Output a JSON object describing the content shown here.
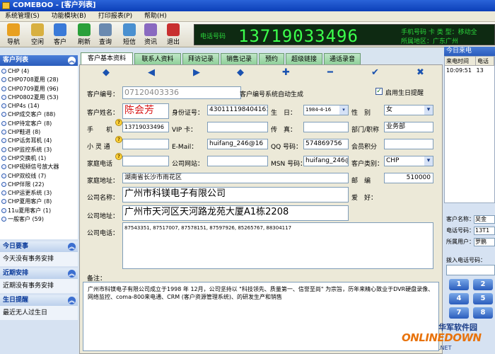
{
  "window": {
    "title": "COMEBOO - [客户列表]"
  },
  "menu": [
    "系统管理(S)",
    "功能模块(B)",
    "打印报表(P)",
    "帮助(H)"
  ],
  "toolbar": {
    "buttons": [
      {
        "label": "导航",
        "icon": "compass-icon",
        "color": "#e8a020"
      },
      {
        "label": "空闲",
        "icon": "pencil-icon",
        "color": "#d8b040"
      },
      {
        "label": "客户",
        "icon": "users-icon",
        "color": "#3a7ad8"
      },
      {
        "label": "刷新",
        "icon": "refresh-icon",
        "color": "#2aa03a"
      },
      {
        "label": "查询",
        "icon": "search-icon",
        "color": "#6a8ab0"
      },
      {
        "label": "短信",
        "icon": "phone-icon",
        "color": "#4a90d0"
      },
      {
        "label": "资讯",
        "icon": "news-icon",
        "color": "#8a6ac0"
      },
      {
        "label": "退出",
        "icon": "exit-icon",
        "color": "#c83030"
      }
    ]
  },
  "phone_panel": {
    "label": "电话号码",
    "number": "13719033496",
    "right_line1": "手机号码   卡 类 型：移动全",
    "right_line2": "所属地区：广东广州"
  },
  "left_panel": {
    "title": "客户列表",
    "items": [
      "CHP (4)",
      "CHP0708夏用 (28)",
      "CHP0709夏用 (96)",
      "CHP0802夏用 (53)",
      "CHP4s (14)",
      "CHP成交客户 (88)",
      "CHP待定客户 (8)",
      "CHP鞋进 (8)",
      "CHP话务耳机 (4)",
      "CHP监控系统 (3)",
      "CHP交换机 (1)",
      "CHP视频信号放大器",
      "CHP双绞线 (7)",
      "CHP伴限 (22)",
      "CHP运更系统 (3)",
      "CHP夏用客户 (8)",
      "11u夏用客户 (1)",
      "一般客户 (59)"
    ],
    "sections": [
      {
        "title": "今日要事",
        "body": "今天没有事务安排"
      },
      {
        "title": "近期安排",
        "body": "近期没有事务安排"
      },
      {
        "title": "生日提醒",
        "body": "最近无人过生日"
      }
    ]
  },
  "tabs": [
    "客户基本资料",
    "联系人资料",
    "拜访记录",
    "销售记录",
    "预约",
    "超级链接",
    "通话录音"
  ],
  "nav": {
    "first": "◆",
    "prev": "◀",
    "next": "▶",
    "last": "◆",
    "add": "✚",
    "delete": "━",
    "save": "✔",
    "cancel": "✖"
  },
  "form": {
    "customer_id_label": "客户编号：",
    "customer_id_value": "07120403336",
    "auto_gen_note": "客户编号系统自动生成",
    "birthday_reminder_label": "启用生日提醒",
    "name_label": "客户姓名：",
    "name_value": "陈会芳",
    "idcard_label": "身份证号：",
    "idcard_value": "430111198404161",
    "birthday_label": "生　日：",
    "birthday_value": "1984-4-16",
    "gender_label": "性　别",
    "gender_value": "女",
    "mobile_label": "手　　机",
    "mobile_value": "13719033496",
    "vip_label": "VIP 卡：",
    "vip_value": "",
    "fax_label": "传　真：",
    "fax_value": "",
    "dept_label": "部门/职称",
    "dept_value": "业务部",
    "xlt_label": "小 灵 通",
    "xlt_value": "",
    "email_label": "E-Mail：",
    "email_value": "huifang_246@16",
    "qq_label": "QQ 号码：",
    "qq_value": "574869756",
    "points_label": "会员积分",
    "points_value": "",
    "home_phone_label": "家庭电话",
    "home_phone_value": "",
    "website_label": "公司网站：",
    "website_value": "",
    "msn_label": "MSN 号码：",
    "msn_value": "huifang_246@",
    "type_label": "客户类别：",
    "type_value": "CHP",
    "home_addr_label": "家庭地址：",
    "home_addr_value": "湖南省长沙市雨花区",
    "postcode_label": "邮　编",
    "postcode_value": "510000",
    "hobby_label": "爱　好：",
    "company_name_label": "公司名称：",
    "company_name_value": "广州市科镁电子有限公司",
    "company_addr_label": "公司地址：",
    "company_addr_value": "广州市天河区天河路龙苑大厦A1栋2208",
    "company_phone_label": "公司电话：",
    "company_phone_value": "87543351, 87517007, 87578151, 87597926, 85265767, 88304117",
    "remark_label": "备注：",
    "remark_value": "广州市科镁电子有限公司成立于1998 年 12月，公司坚持以 \"科技领先、质量第一、信誉至尚\" 为宗旨，历年来精心致业于DVR硬盘录像、网络监控、coma-800来电通、CRM (客户资源管理系统)、的研发生产和销售"
  },
  "right_panel": {
    "title": "今日来电",
    "col_time": "来电时间",
    "col_phone": "电话",
    "row_time": "10:09:51",
    "row_phone": "13",
    "customer_name_label": "客户名称：",
    "customer_name_value": "吴金",
    "phone_label": "电话号码：",
    "phone_value": "13T1",
    "user_label": "所属用户：",
    "user_value": "罗鹏",
    "dial_label": "拨入电话号码：",
    "keys": [
      "1",
      "2",
      "4",
      "5",
      "7",
      "8"
    ]
  },
  "watermark": {
    "line1": "华军软件园",
    "line2": "ONLINEDOWN",
    "line3": ".NET"
  }
}
